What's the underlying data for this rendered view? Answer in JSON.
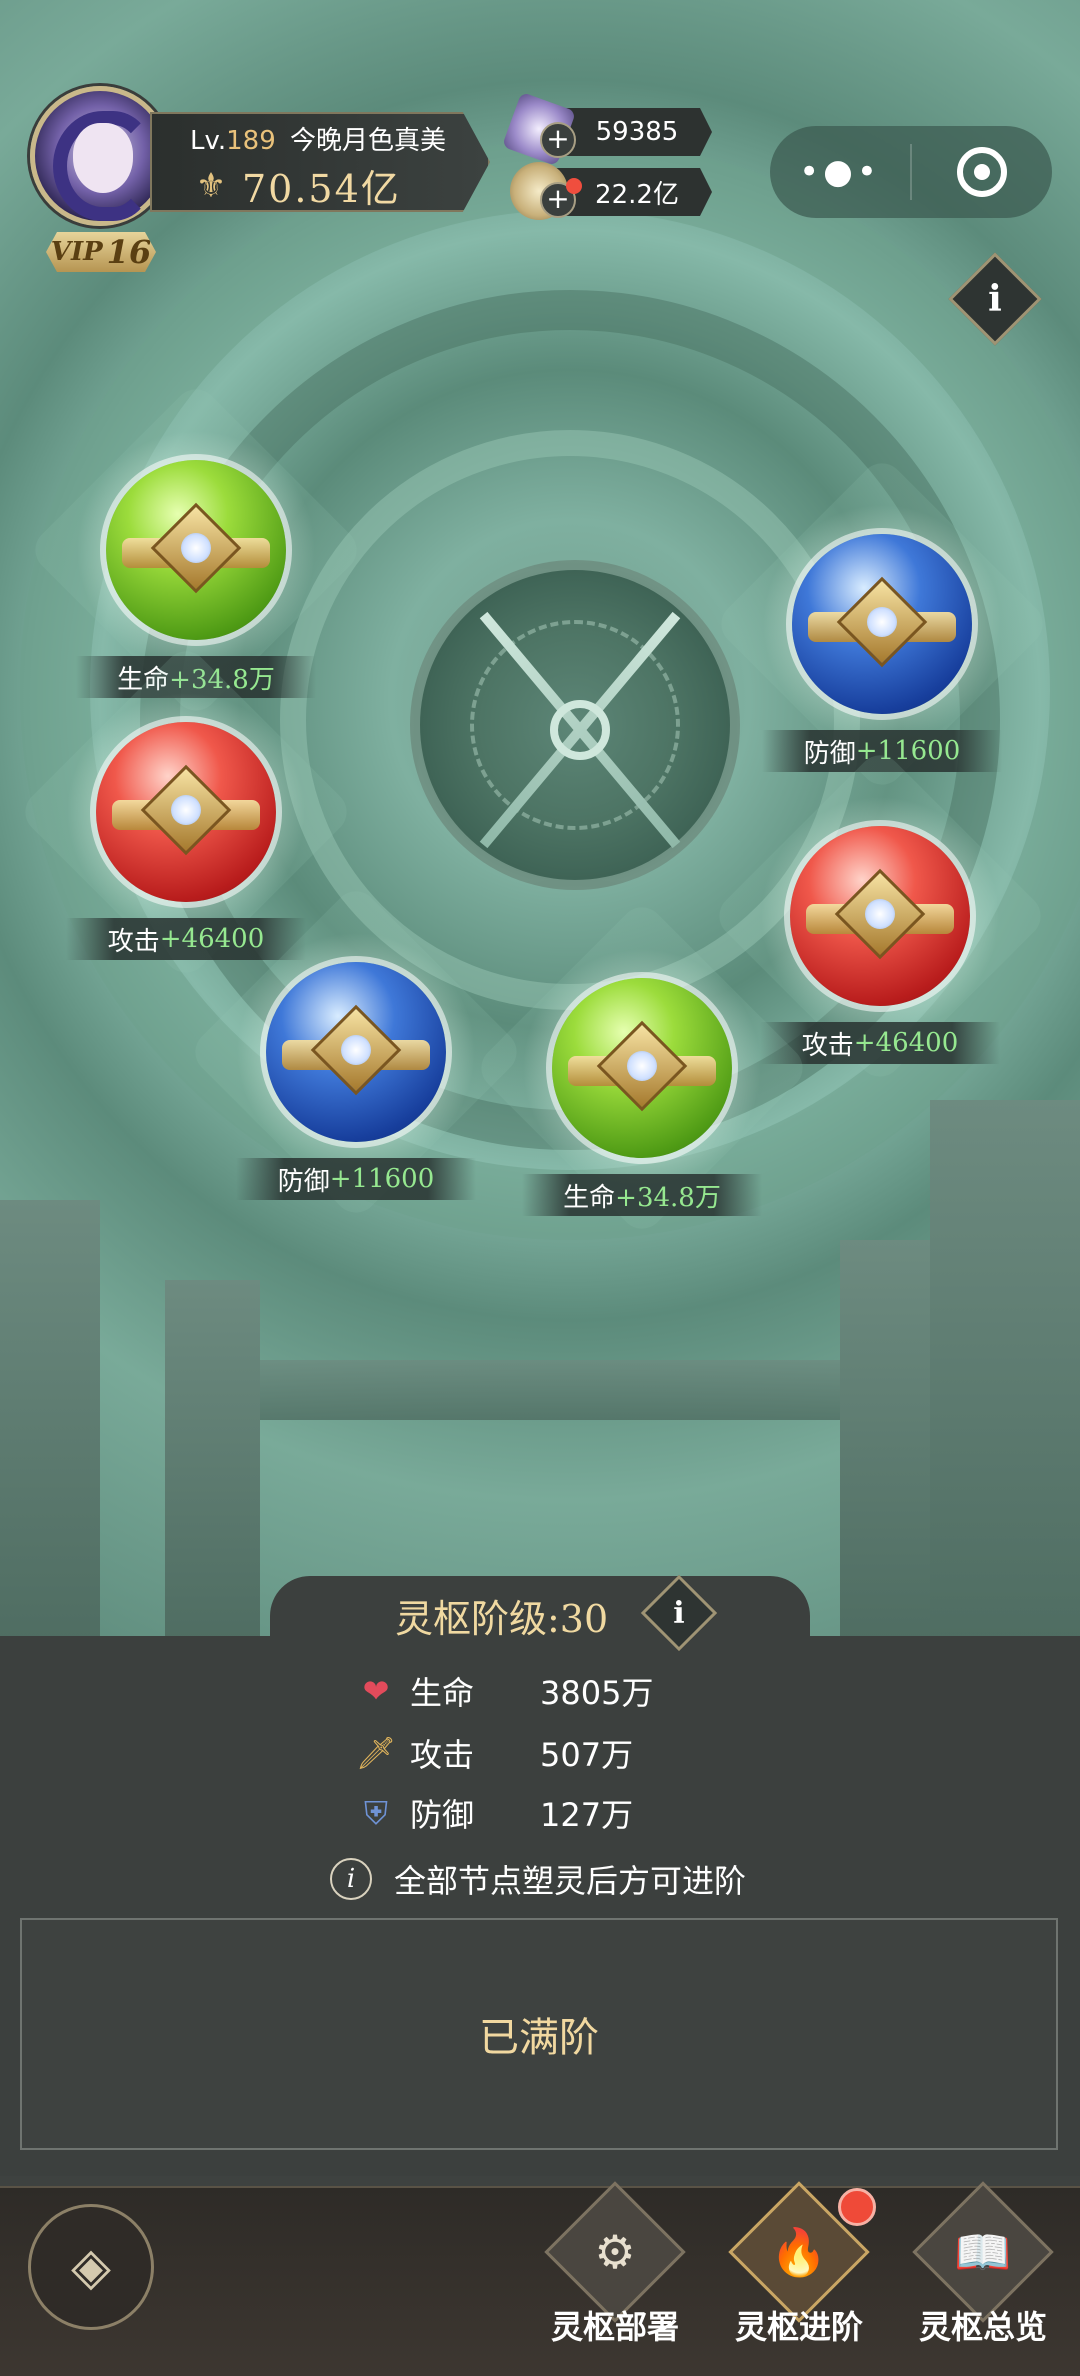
{
  "player": {
    "level_prefix": "Lv.",
    "level": "189",
    "name": "今晚月色真美",
    "power": "70.54亿",
    "vip_label": "VIP",
    "vip_level": "16"
  },
  "resources": [
    {
      "name": "gem",
      "value": "59385",
      "icon": "crystal-icon",
      "has_dot": false
    },
    {
      "name": "coin",
      "value": "22.2亿",
      "icon": "coin-icon",
      "has_dot": true
    }
  ],
  "capsule": {
    "more_icon": "more-dots-icon",
    "close_icon": "target-icon"
  },
  "info_glyph": "i",
  "nodes": [
    {
      "color": "green",
      "stat": "生命",
      "value": "+34.8万"
    },
    {
      "color": "blue",
      "stat": "防御",
      "value": "+11600"
    },
    {
      "color": "red",
      "stat": "攻击",
      "value": "+46400"
    },
    {
      "color": "red",
      "stat": "攻击",
      "value": "+46400"
    },
    {
      "color": "blue",
      "stat": "防御",
      "value": "+11600"
    },
    {
      "color": "green",
      "stat": "生命",
      "value": "+34.8万"
    }
  ],
  "panel": {
    "stage_title": "灵枢阶级:30",
    "stats": [
      {
        "name": "生命",
        "value": "3805万",
        "icon": "heart-icon",
        "color": "#e24b5b"
      },
      {
        "name": "攻击",
        "value": "507万",
        "icon": "sword-icon",
        "color": "#e1b55c"
      },
      {
        "name": "防御",
        "value": "127万",
        "icon": "shield-icon",
        "color": "#6f93d6"
      }
    ],
    "hint": "全部节点塑灵后方可进阶",
    "hint_glyph": "i",
    "maxed_label": "已满阶"
  },
  "nav": {
    "back_icon": "back-arrow-icon",
    "items": [
      {
        "label": "灵枢部署",
        "icon": "deploy-icon",
        "active": false
      },
      {
        "label": "灵枢进阶",
        "icon": "flame-icon",
        "active": true,
        "has_dot": true
      },
      {
        "label": "灵枢总览",
        "icon": "book-icon",
        "active": false
      }
    ]
  },
  "colors": {
    "accent_gold": "#f0d9a1",
    "stat_green": "#96e890",
    "panel_bg": "#3c403e"
  }
}
